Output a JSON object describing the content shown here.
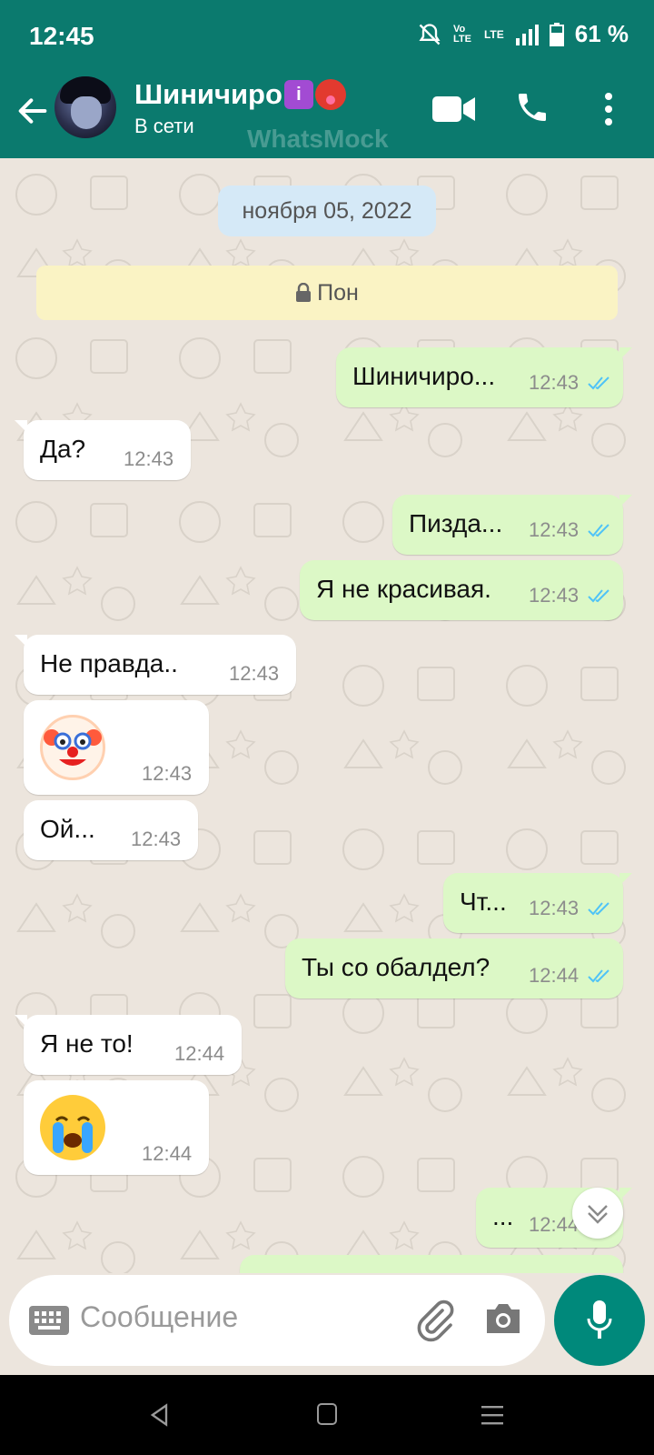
{
  "status_bar": {
    "time": "12:45",
    "battery": "61 %",
    "network": "LTE",
    "volte": "Vo LTE"
  },
  "header": {
    "contact_name": "Шиничиро",
    "status": "В сети",
    "watermark": "WhatsMock"
  },
  "chat": {
    "date_chip": "ноября 05, 2022",
    "notice": "Пон",
    "messages": [
      {
        "direction": "out",
        "text": "Шиничиро...",
        "time": "12:43",
        "read": true
      },
      {
        "direction": "in",
        "text": "Да?",
        "time": "12:43"
      },
      {
        "direction": "out",
        "text": "Пизда...",
        "time": "12:43",
        "read": true
      },
      {
        "direction": "out",
        "text": "Я не красивая.",
        "time": "12:43",
        "read": true
      },
      {
        "direction": "in",
        "text": "Не правда..",
        "time": "12:43"
      },
      {
        "direction": "in",
        "emoji": "clown-face",
        "time": "12:43"
      },
      {
        "direction": "in",
        "text": "Ой...",
        "time": "12:43"
      },
      {
        "direction": "out",
        "text": "Чт...",
        "time": "12:43",
        "read": true
      },
      {
        "direction": "out",
        "text": "Ты со обалдел?",
        "time": "12:44",
        "read": true
      },
      {
        "direction": "in",
        "text": "Я не то!",
        "time": "12:44"
      },
      {
        "direction": "in",
        "emoji": "loudly-crying-face",
        "time": "12:44"
      },
      {
        "direction": "out",
        "text": "...",
        "time": "12:44",
        "read": true
      }
    ]
  },
  "composer": {
    "placeholder": "Сообщение"
  },
  "colors": {
    "header": "#0B7A6E",
    "outgoing_bubble": "#DCF8C6",
    "incoming_bubble": "#FFFFFF",
    "background": "#ECE5DD",
    "read_ticks": "#4FC3F7",
    "mic_button": "#00897B"
  }
}
